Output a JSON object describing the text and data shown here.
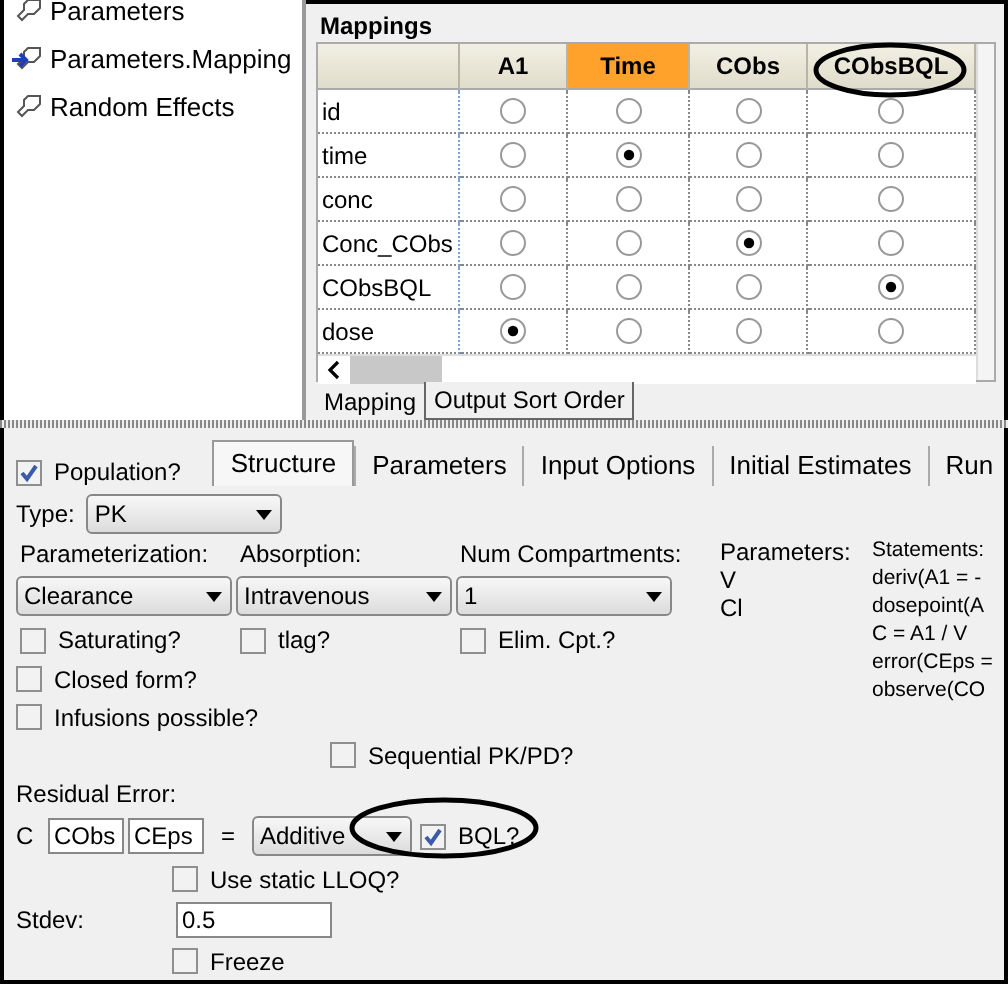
{
  "tree": {
    "items": [
      {
        "label": "Parameters",
        "current": false
      },
      {
        "label": "Parameters.Mapping",
        "current": true
      },
      {
        "label": "Random Effects",
        "current": false
      }
    ]
  },
  "mappings": {
    "title": "Mappings",
    "columns": [
      {
        "label": "A1",
        "highlighted": false
      },
      {
        "label": "Time",
        "highlighted": true
      },
      {
        "label": "CObs",
        "highlighted": false
      },
      {
        "label": "CObsBQL",
        "highlighted": false
      }
    ],
    "rows": [
      {
        "name": "id",
        "options": [
          {
            "selected": false
          },
          {
            "selected": false
          },
          {
            "selected": false
          },
          {
            "selected": false
          }
        ]
      },
      {
        "name": "time",
        "options": [
          {
            "selected": false
          },
          {
            "selected": true
          },
          {
            "selected": false
          },
          {
            "selected": false
          }
        ]
      },
      {
        "name": "conc",
        "options": [
          {
            "selected": false
          },
          {
            "selected": false
          },
          {
            "selected": false
          },
          {
            "selected": false
          }
        ]
      },
      {
        "name": "Conc_CObs",
        "options": [
          {
            "selected": false
          },
          {
            "selected": false
          },
          {
            "selected": true
          },
          {
            "selected": false
          }
        ]
      },
      {
        "name": "CObsBQL",
        "options": [
          {
            "selected": false
          },
          {
            "selected": false
          },
          {
            "selected": false
          },
          {
            "selected": true
          }
        ]
      },
      {
        "name": "dose",
        "options": [
          {
            "selected": true
          },
          {
            "selected": false
          },
          {
            "selected": false
          },
          {
            "selected": false
          }
        ]
      }
    ],
    "tabs": [
      {
        "label": "Mapping",
        "selected": true
      },
      {
        "label": "Output Sort Order",
        "selected": false
      }
    ]
  },
  "model": {
    "population": {
      "label": "Population?",
      "checked": true
    },
    "tabs": [
      {
        "label": "Structure",
        "selected": true
      },
      {
        "label": "Parameters",
        "selected": false
      },
      {
        "label": "Input Options",
        "selected": false
      },
      {
        "label": "Initial Estimates",
        "selected": false
      },
      {
        "label": "Run",
        "selected": false
      }
    ],
    "type": {
      "label": "Type:",
      "value": "PK"
    },
    "dropdowns": [
      {
        "label": "Parameterization:",
        "value": "Clearance"
      },
      {
        "label": "Absorption:",
        "value": "Intravenous"
      },
      {
        "label": "Num Compartments:",
        "value": "1"
      }
    ],
    "options_row": [
      {
        "label": "Saturating?",
        "checked": false
      },
      {
        "label": "tlag?",
        "checked": false
      },
      {
        "label": "Elim. Cpt.?",
        "checked": false
      }
    ],
    "options": [
      {
        "label": "Closed form?",
        "checked": false
      },
      {
        "label": "Infusions possible?",
        "checked": false
      }
    ],
    "sequential": {
      "label": "Sequential PK/PD?",
      "checked": false
    },
    "parameters": {
      "label": "Parameters:",
      "items": [
        "V",
        "Cl"
      ]
    },
    "statements": {
      "label": "Statements:",
      "lines": [
        "deriv(A1 = -",
        "dosepoint(A",
        "C = A1 / V",
        "error(CEps =",
        "observe(CO"
      ]
    },
    "residual": {
      "label": "Residual Error:",
      "prefix": "C",
      "observed": "CObs",
      "epsilon": "CEps",
      "equals": "=",
      "error_type": "Additive",
      "bql": {
        "label": "BQL?",
        "checked": true
      }
    },
    "lloq": {
      "label": "Use static LLOQ?",
      "checked": false
    },
    "stdev": {
      "label": "Stdev:",
      "value": "0.5"
    },
    "freeze": {
      "label": "Freeze",
      "checked": false
    }
  }
}
